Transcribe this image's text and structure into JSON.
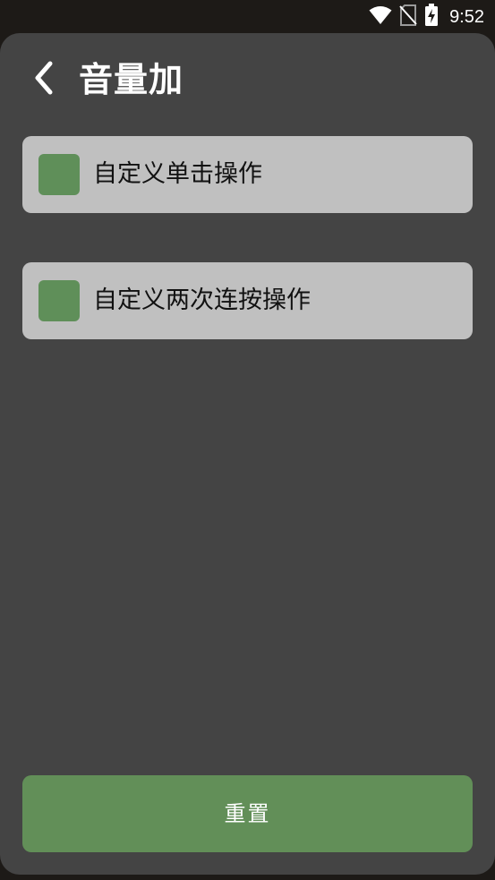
{
  "status_bar": {
    "time": "9:52",
    "icons": [
      "wifi-icon",
      "no-sim-icon",
      "battery-charging-icon"
    ]
  },
  "header": {
    "title": "音量加",
    "back_icon": "chevron-left-icon"
  },
  "options": [
    {
      "label": "自定义单击操作",
      "checked": false
    },
    {
      "label": "自定义两次连按操作",
      "checked": false
    }
  ],
  "footer": {
    "reset_label": "重置"
  },
  "colors": {
    "background": "#1d1a17",
    "panel": "#444444",
    "row": "#c0c0c0",
    "checkbox": "#5f8f59",
    "accent_button": "#628f58",
    "text_light": "#ffffff",
    "text_dark": "#111111"
  }
}
